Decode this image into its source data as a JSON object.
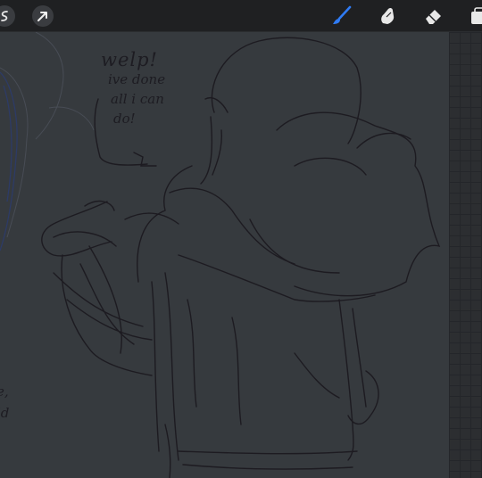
{
  "toolbar": {
    "left_tools": [
      {
        "name": "selection-tool",
        "icon": "s-curve-icon"
      },
      {
        "name": "transform-tool",
        "icon": "arrow-cursor-icon"
      }
    ],
    "right_tools": [
      {
        "name": "brush-tool",
        "icon": "paintbrush-icon",
        "active": true
      },
      {
        "name": "smudge-tool",
        "icon": "finger-smudge-icon"
      },
      {
        "name": "eraser-tool",
        "icon": "eraser-icon"
      },
      {
        "name": "layers-tool",
        "icon": "layers-icon"
      }
    ],
    "active_color": "#2f7bf4"
  },
  "canvas": {
    "background_color": "#363a3e",
    "speech_bubble": {
      "line1": "welp!",
      "line2": "ive done",
      "line3": "all i can",
      "line4": "do!"
    },
    "edge_text": {
      "line1": "e,",
      "line2": "ld"
    }
  }
}
